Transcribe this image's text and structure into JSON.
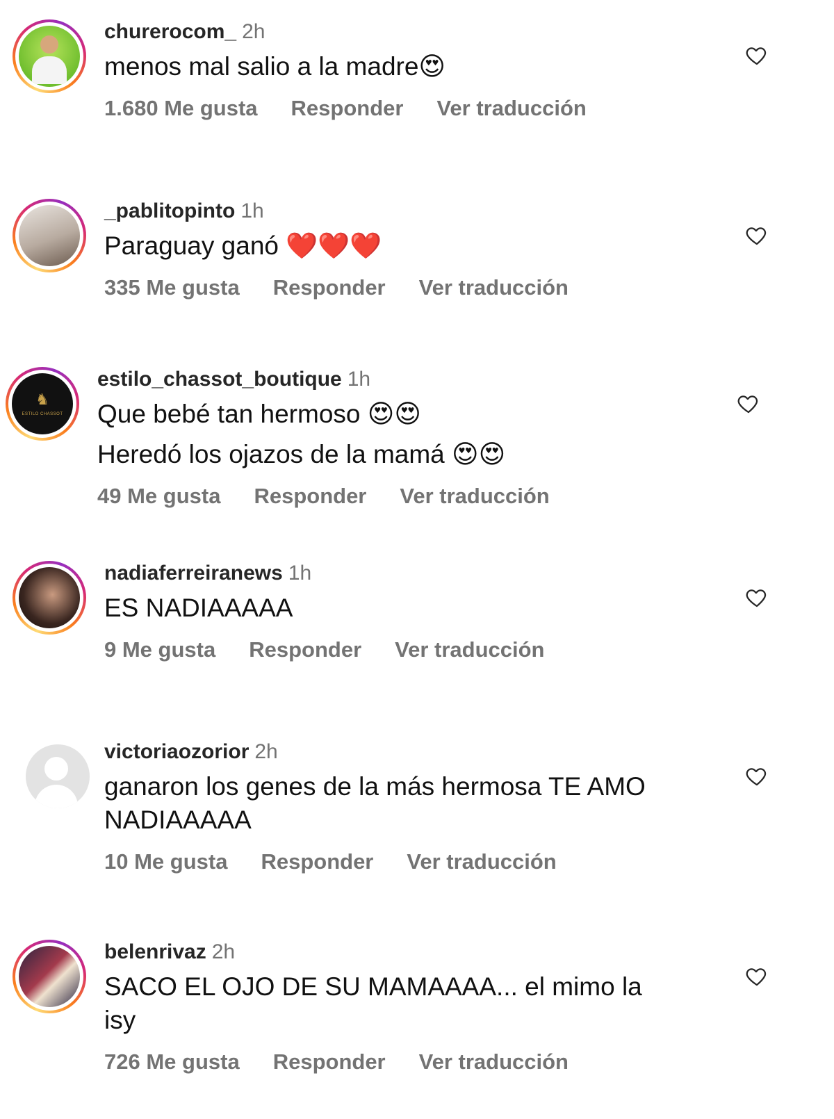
{
  "comments": [
    {
      "username": "churerocom_",
      "time": "2h",
      "lines": [
        "menos mal salio a la madre😍"
      ],
      "likes": "1.680 Me gusta",
      "reply": "Responder",
      "translate": "Ver traducción"
    },
    {
      "username": "_pablitopinto",
      "time": "1h",
      "lines": [
        "Paraguay ganó ❤️❤️❤️"
      ],
      "likes": "335 Me gusta",
      "reply": "Responder",
      "translate": "Ver traducción"
    },
    {
      "username": "estilo_chassot_boutique",
      "time": "1h",
      "lines": [
        "Que bebé tan hermoso 😍😍",
        "Heredó los ojazos de la mamá 😍😍"
      ],
      "likes": "49 Me gusta",
      "reply": "Responder",
      "translate": "Ver traducción"
    },
    {
      "username": "nadiaferreiranews",
      "time": "1h",
      "lines": [
        "ES NADIAAAAA"
      ],
      "likes": "9 Me gusta",
      "reply": "Responder",
      "translate": "Ver traducción"
    },
    {
      "username": "victoriaozorior",
      "time": "2h",
      "lines": [
        "ganaron los genes de la más hermosa TE AMO",
        "NADIAAAAA"
      ],
      "likes": "10 Me gusta",
      "reply": "Responder",
      "translate": "Ver traducción"
    },
    {
      "username": "belenrivaz",
      "time": "2h",
      "lines": [
        "SACO EL OJO DE SU MAMAAAA... el mimo la",
        "isy"
      ],
      "likes": "726 Me gusta",
      "reply": "Responder",
      "translate": "Ver traducción"
    }
  ],
  "icons": {
    "like": "heart-outline-icon",
    "default_avatar": "person-silhouette-icon"
  },
  "colors": {
    "text": "#262626",
    "muted": "#737373",
    "story_ring": "#d62976"
  }
}
